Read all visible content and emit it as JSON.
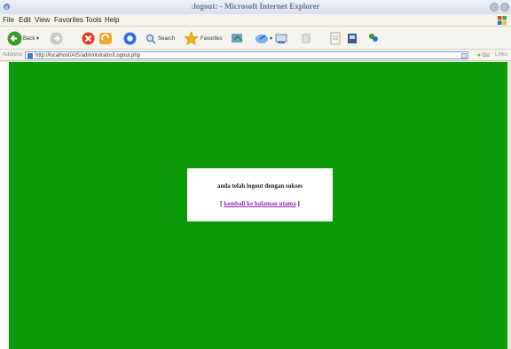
{
  "window": {
    "title": ":logout: - Microsoft Internet Explorer"
  },
  "menubar": {
    "items": [
      "File",
      "Edit",
      "View",
      "Favorites",
      "Tools",
      "Help"
    ]
  },
  "toolbar": {
    "back_label": "Back",
    "search_label": "Search",
    "favorites_label": "Favorites"
  },
  "address": {
    "label": "Address",
    "url": "http://localhost/AIS/administrator/Logout.php",
    "go_label": "Go",
    "links_label": "Links"
  },
  "page": {
    "background_color": "#0a9a0a",
    "message": "anda telah logout dengan sukses",
    "link_open": "[",
    "link_text": "kembali ke halaman utama",
    "link_close": "]"
  }
}
